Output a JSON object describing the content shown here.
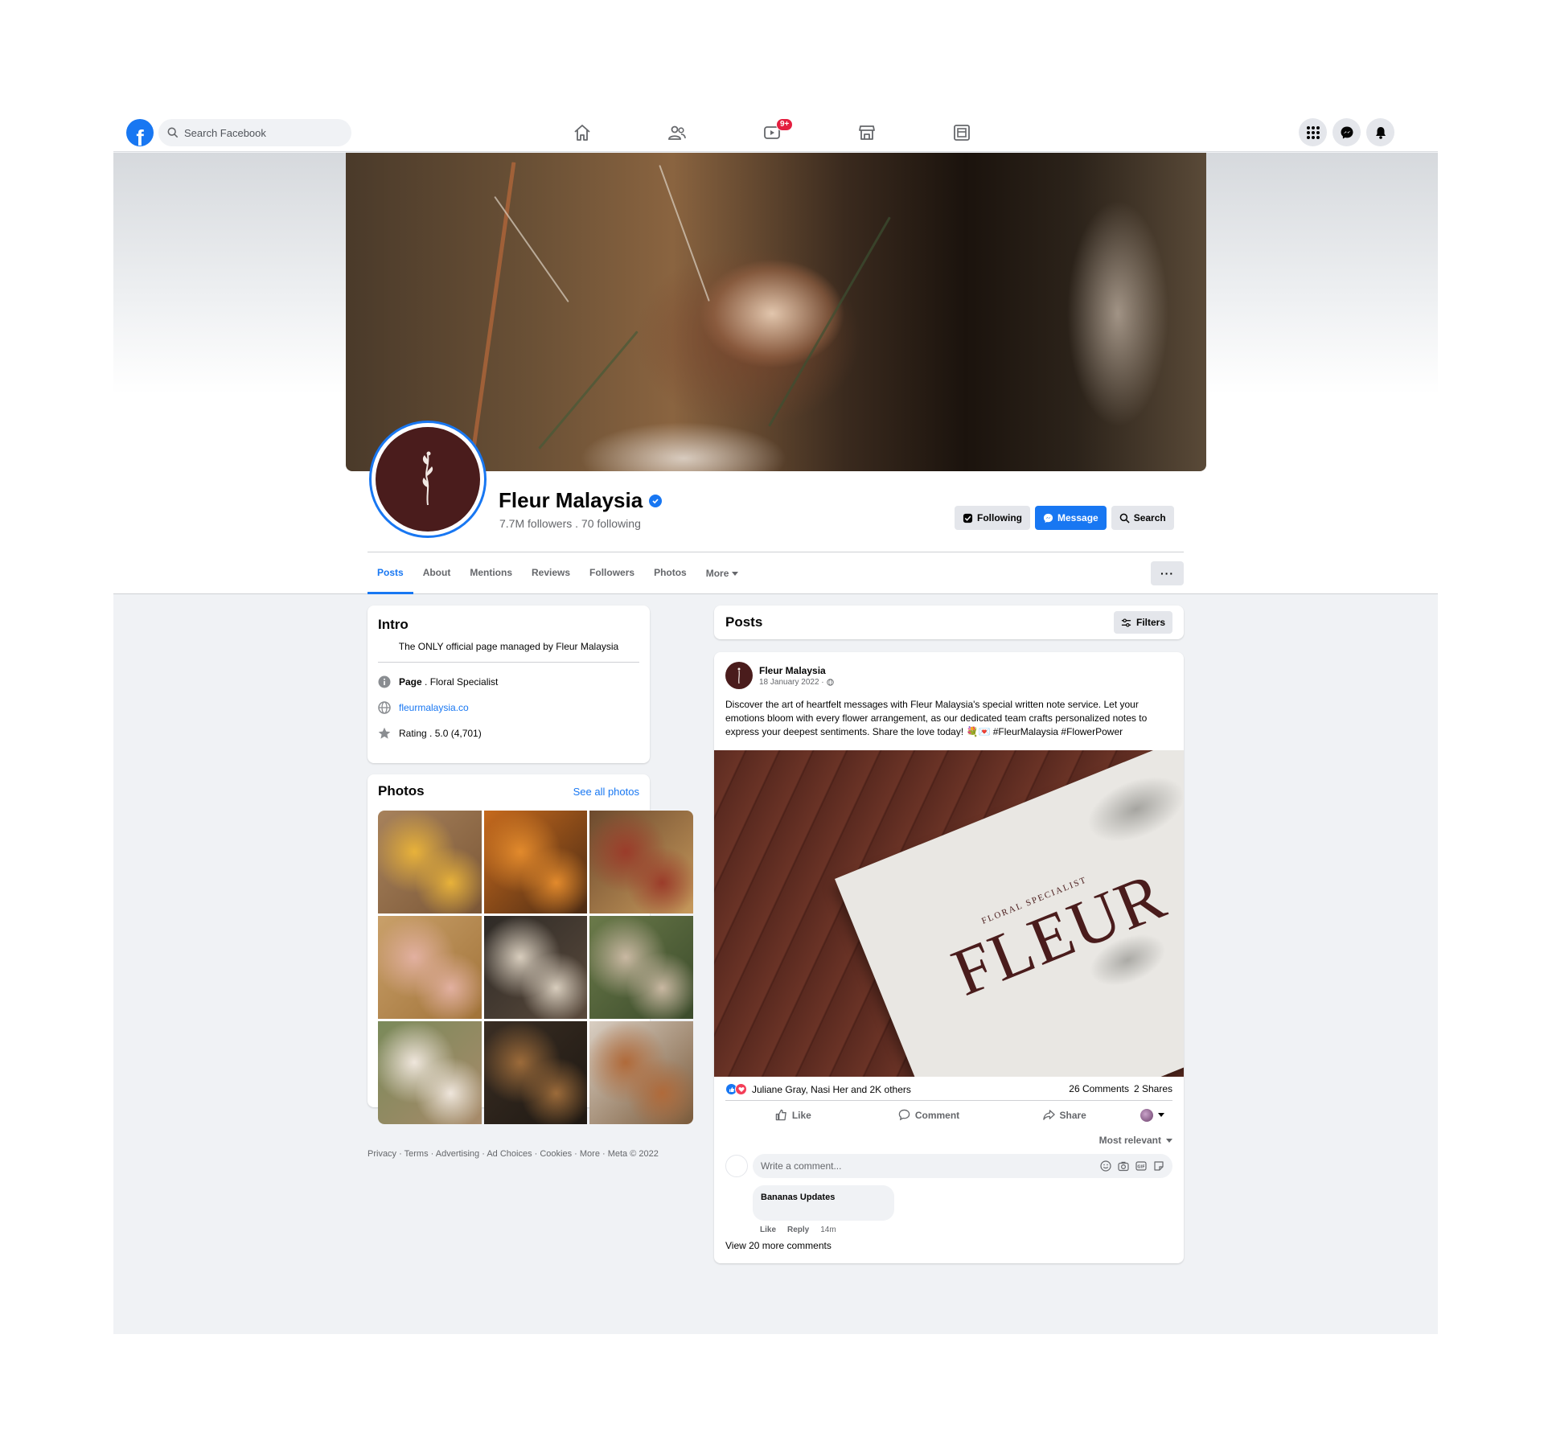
{
  "topnav": {
    "logo": "f",
    "search_placeholder": "Search Facebook",
    "watch_badge": "9+"
  },
  "page": {
    "name": "Fleur Malaysia",
    "followers": "7.7M followers . 70 following",
    "actions": {
      "following": "Following",
      "message": "Message",
      "search": "Search"
    },
    "tabs": [
      "Posts",
      "About",
      "Mentions",
      "Reviews",
      "Followers",
      "Photos",
      "More"
    ],
    "dots": "···"
  },
  "intro": {
    "title": "Intro",
    "description": "The ONLY official page managed by Fleur Malaysia",
    "page_label": "Page",
    "page_category": " . Floral Specialist",
    "website": "fleurmalaysia.co",
    "rating_label": "Rating",
    "rating_value": " . 5.0 (4,701)"
  },
  "photos": {
    "title": "Photos",
    "see_all": "See all photos",
    "tiles": [
      {
        "colors": [
          "#a7825c",
          "#e8b23a",
          "#7a5636"
        ]
      },
      {
        "colors": [
          "#c66a1d",
          "#e28a2c",
          "#4a2a14"
        ]
      },
      {
        "colors": [
          "#6d4a2e",
          "#9b3c2a",
          "#c79a5c"
        ]
      },
      {
        "colors": [
          "#c9a06a",
          "#e2b0a0",
          "#a07238"
        ]
      },
      {
        "colors": [
          "#2e2a26",
          "#d8cdbd",
          "#5a4a3c"
        ]
      },
      {
        "colors": [
          "#6b7a4a",
          "#c9b8a2",
          "#3a4a2a"
        ]
      },
      {
        "colors": [
          "#7a8a5a",
          "#efe6dc",
          "#a88a6a"
        ]
      },
      {
        "colors": [
          "#3a2e24",
          "#9c6b3a",
          "#1e1812"
        ]
      },
      {
        "colors": [
          "#d9cfc3",
          "#b06a3a",
          "#7a5a3a"
        ]
      }
    ]
  },
  "footer": "Privacy · Terms · Advertising · Ad Choices · Cookies · More · Meta © 2022",
  "posts": {
    "title": "Posts",
    "filters": "Filters"
  },
  "post": {
    "author": "Fleur Malaysia",
    "date": "18 January 2022 ·",
    "text": "Discover the art of heartfelt messages with Fleur Malaysia's special written note service. Let your emotions bloom with every flower arrangement, as our dedicated team crafts personalized notes to express your deepest sentiments. Share the love today! 💐💌 #FleurMalaysia #FlowerPower",
    "image_text": {
      "logo": "FLEUR",
      "sub": "FLORAL SPECIALIST"
    },
    "reactions_text": "Juliane Gray, Nasi Her and 2K others",
    "comments_count": "26 Comments",
    "shares_count": "2 Shares",
    "actions": {
      "like": "Like",
      "comment": "Comment",
      "share": "Share"
    },
    "sort": "Most relevant",
    "comment_placeholder": "Write a comment...",
    "top_comment_author": "Bananas Updates",
    "comment_like": "Like",
    "comment_reply": "Reply",
    "comment_time": "14m",
    "view_more": "View 20 more comments"
  },
  "colors": {
    "brand": "#1877f2",
    "maroon": "#4a1c1c",
    "bg": "#f0f2f5"
  }
}
